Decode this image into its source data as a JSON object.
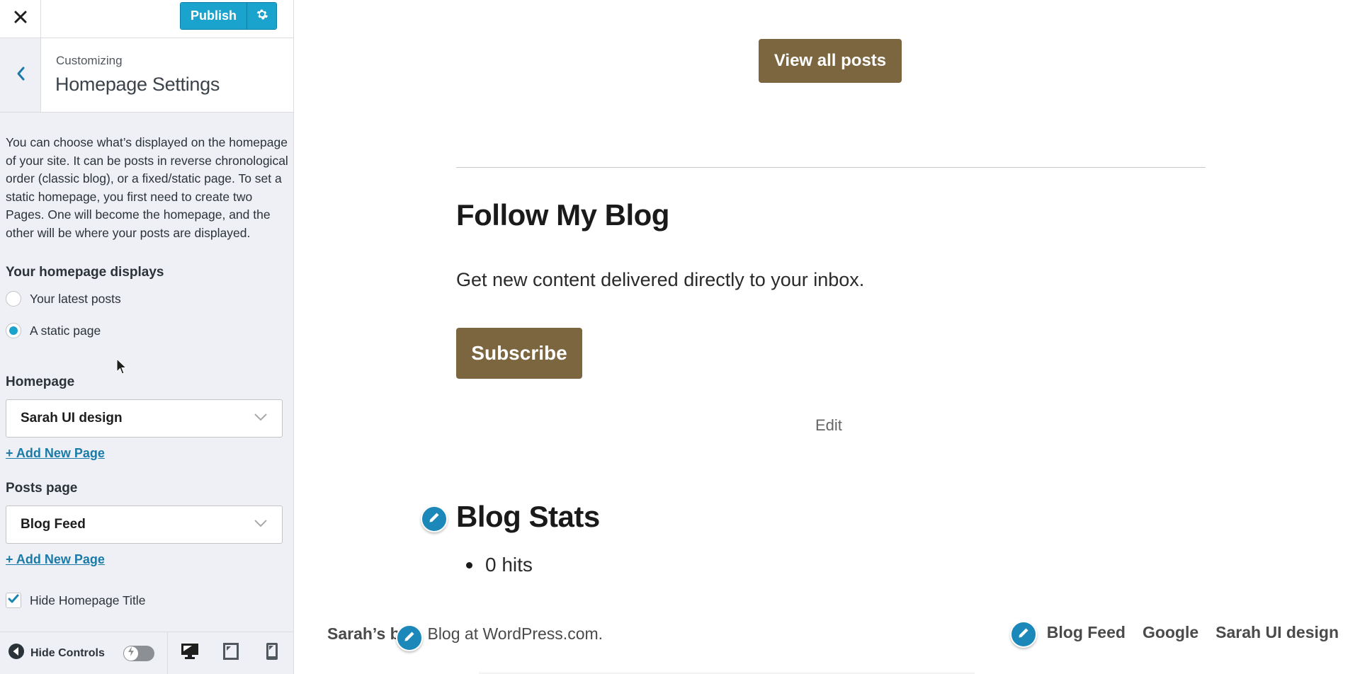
{
  "header": {
    "publish_label": "Publish",
    "close_icon": "close-icon",
    "settings_icon": "gear-icon"
  },
  "section": {
    "breadcrumb": "Customizing",
    "title": "Homepage Settings",
    "back_icon": "chevron-left-icon"
  },
  "description": "You can choose what’s displayed on the homepage of your site. It can be posts in reverse chronological order (classic blog), or a fixed/static page. To set a static homepage, you first need to create two Pages. One will become the homepage, and the other will be where your posts are displayed.",
  "homepage_displays": {
    "label": "Your homepage displays",
    "options": [
      {
        "label": "Your latest posts",
        "selected": false
      },
      {
        "label": "A static page",
        "selected": true
      }
    ]
  },
  "homepage": {
    "label": "Homepage",
    "selected": "Sarah UI design",
    "add_link": "+ Add New Page"
  },
  "posts_page": {
    "label": "Posts page",
    "selected": "Blog Feed",
    "add_link": "+ Add New Page"
  },
  "hide_title": {
    "label": "Hide Homepage Title",
    "checked": true
  },
  "footer_controls": {
    "hide_controls_label": "Hide Controls",
    "devices": [
      "desktop",
      "tablet",
      "mobile"
    ]
  },
  "preview": {
    "view_all_label": "View all posts",
    "follow": {
      "title": "Follow My Blog",
      "description": "Get new content delivered directly to your inbox.",
      "subscribe_label": "Subscribe",
      "edit_label": "Edit"
    },
    "stats": {
      "title": "Blog Stats",
      "items": [
        "0 hits"
      ]
    },
    "footer": {
      "site_name": "Sarah’s b",
      "credit": ", Blog at WordPress.com.",
      "menu": [
        "Blog Feed",
        "Google",
        "Sarah UI design"
      ]
    }
  },
  "colors": {
    "accent": "#1aa3cc",
    "button_brown": "#7c6640",
    "edit_badge": "#1c88b9",
    "link": "#1a7aa8"
  }
}
